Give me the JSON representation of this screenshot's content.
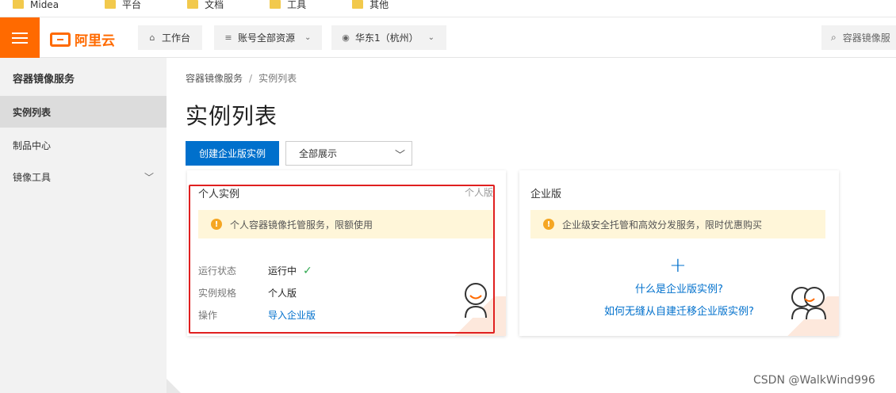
{
  "bookmarks": [
    "Midea",
    "平台",
    "文档",
    "工具",
    "其他"
  ],
  "topnav": {
    "logo_text": "阿里云",
    "workbench": "工作台",
    "resources": "账号全部资源",
    "region": "华东1（杭州）",
    "search_placeholder": "容器镜像服",
    "brand_color": "#ff6a00"
  },
  "sidebar": {
    "title": "容器镜像服务",
    "items": [
      {
        "label": "实例列表",
        "active": true
      },
      {
        "label": "制品中心",
        "active": false
      },
      {
        "label": "镜像工具",
        "active": false
      }
    ]
  },
  "breadcrumb": {
    "root": "容器镜像服务",
    "sep": "/",
    "current": "实例列表"
  },
  "page_title": "实例列表",
  "actions": {
    "create_button": "创建企业版实例",
    "filter_selected": "全部展示"
  },
  "cards": {
    "personal": {
      "title": "个人实例",
      "tag": "个人版",
      "notice": "个人容器镜像托管服务，限额使用",
      "rows": [
        {
          "label": "运行状态",
          "value": "运行中"
        },
        {
          "label": "实例规格",
          "value": "个人版"
        },
        {
          "label": "操作",
          "value": "导入企业版"
        }
      ]
    },
    "enterprise": {
      "title": "企业版",
      "notice": "企业级安全托管和高效分发服务，限时优惠购买",
      "plus": "+",
      "link1": "什么是企业版实例?",
      "link2": "如何无缝从自建迁移企业版实例?"
    }
  },
  "watermark": "CSDN @WalkWind996",
  "colors": {
    "primary": "#0070cc",
    "warning": "#f5a623",
    "success": "#2fa84f",
    "highlight": "#e02020"
  }
}
